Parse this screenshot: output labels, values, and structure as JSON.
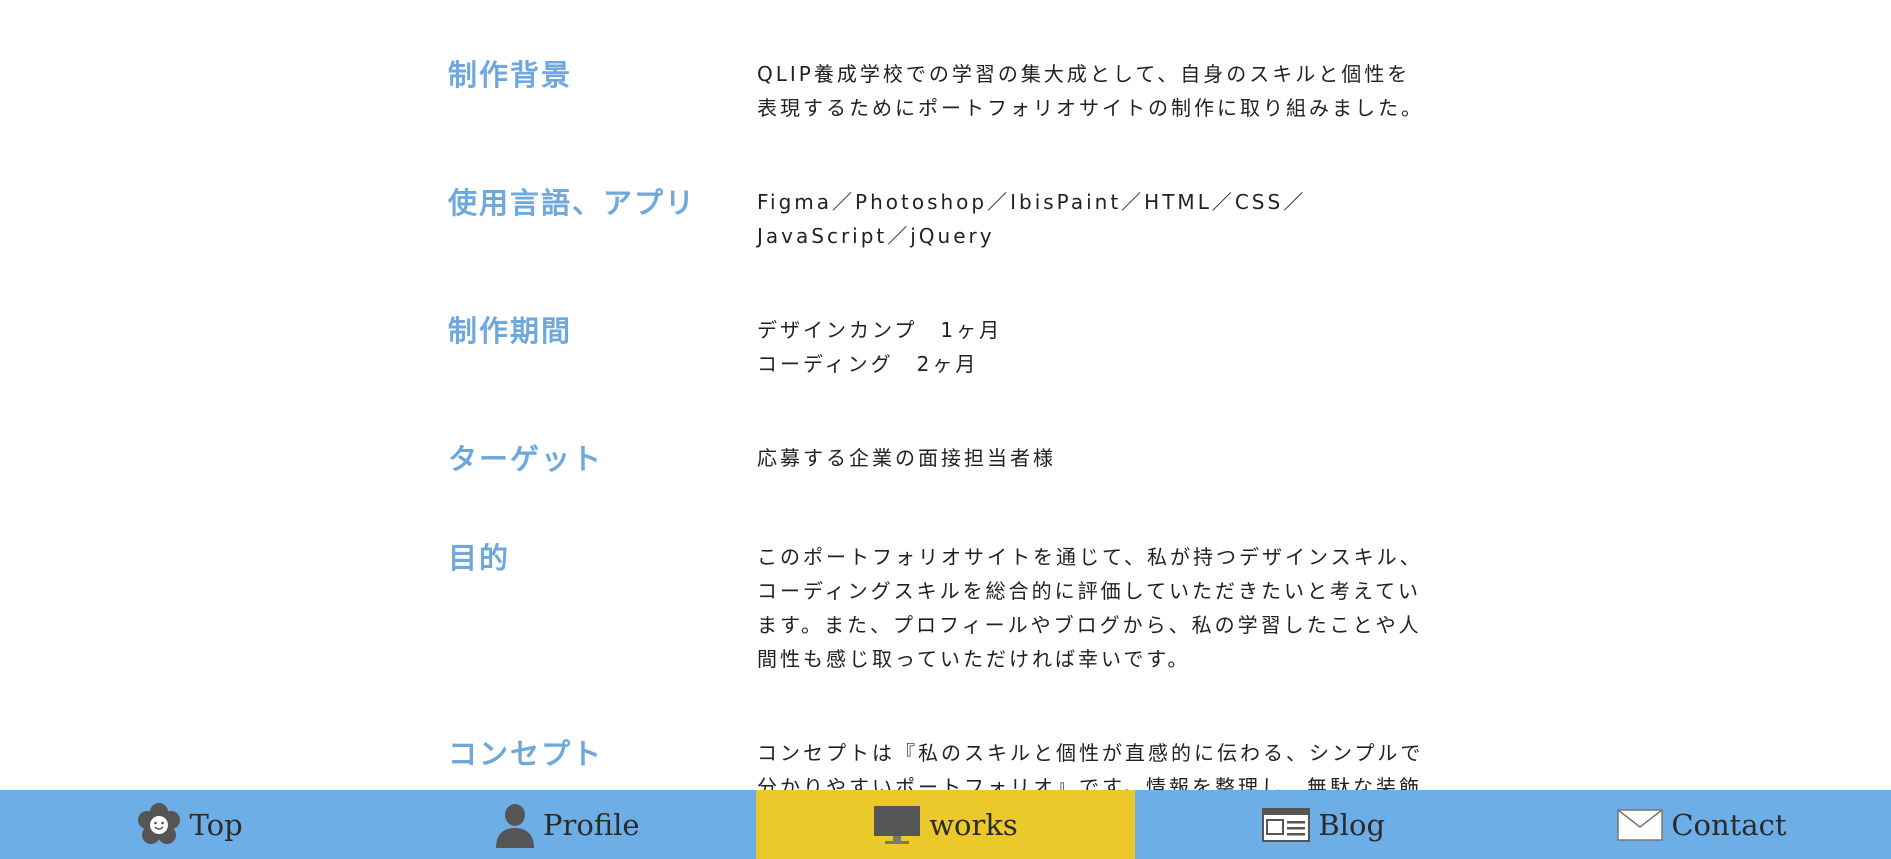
{
  "sections": [
    {
      "label": "制作背景",
      "lines": [
        "QLIP養成学校での学習の集大成として、自身のスキルと個性を",
        "表現するためにポートフォリオサイトの制作に取り組みました。"
      ]
    },
    {
      "label": "使用言語、アプリ",
      "lines": [
        "Figma／Photoshop／IbisPaint／HTML／CSS／",
        "JavaScript／jQuery"
      ]
    },
    {
      "label": "制作期間",
      "lines": [
        "デザインカンプ　1ヶ月",
        "コーディング　2ヶ月"
      ]
    },
    {
      "label": "ターゲット",
      "lines": [
        "応募する企業の面接担当者様"
      ]
    },
    {
      "label": "目的",
      "lines": [
        "このポートフォリオサイトを通じて、私が持つデザインスキル、",
        "コーディングスキルを総合的に評価していただきたいと考えてい",
        "ます。また、プロフィールやブログから、私の学習したことや人",
        "間性も感じ取っていただければ幸いです。"
      ]
    },
    {
      "label": "コンセプト",
      "lines": [
        "コンセプトは『私のスキルと個性が直感的に伝わる、シンプルで",
        "分かりやすいポートフォリオ』です。情報を整理し、無駄な装飾"
      ]
    }
  ],
  "nav": {
    "items": [
      {
        "label": "Top",
        "icon": "flower-icon"
      },
      {
        "label": "Profile",
        "icon": "person-icon"
      },
      {
        "label": "works",
        "icon": "monitor-icon",
        "active": true
      },
      {
        "label": "Blog",
        "icon": "newspaper-icon"
      },
      {
        "label": "Contact",
        "icon": "envelope-icon"
      }
    ]
  },
  "colors": {
    "label": "#6fa8dc",
    "navbar": "#6eaee6",
    "nav_active": "#ecc92b",
    "icon": "#555555"
  }
}
